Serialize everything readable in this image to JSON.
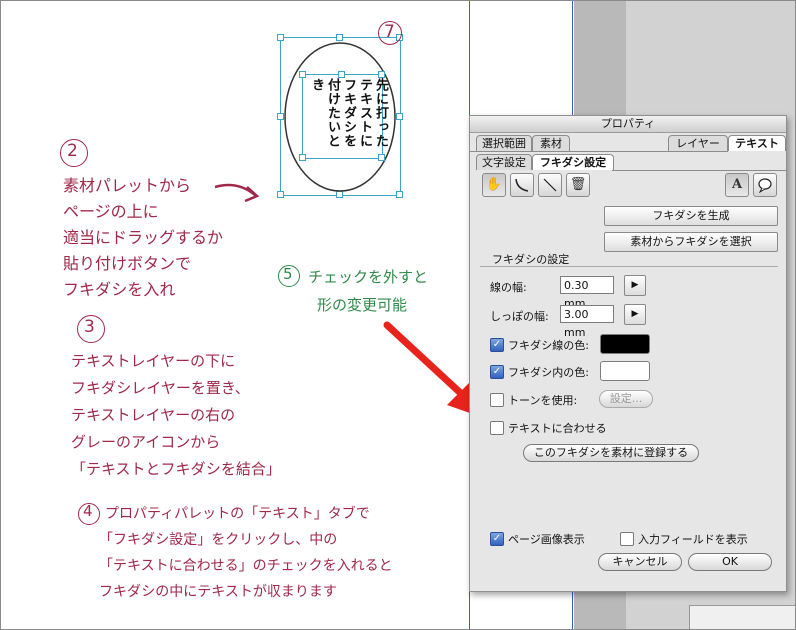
{
  "annotations": {
    "step2": {
      "number": "2",
      "lines": [
        "素材パレットから",
        "ページの上に",
        "適当にドラッグするか",
        "貼り付けボタンで",
        "フキダシを入れ"
      ]
    },
    "step3": {
      "number": "3",
      "lines": [
        "テキストレイヤーの下に",
        "フキダシレイヤーを置き、",
        "テキストレイヤーの右の",
        "グレーのアイコンから",
        "「テキストとフキダシを結合」"
      ]
    },
    "step4": {
      "number": "4",
      "lines": [
        "プロパティパレットの「テキスト」タブで",
        "「フキダシ設定」をクリックし、中の",
        "「テキストに合わせる」のチェックを入れると",
        "フキダシの中にテキストが収まります"
      ]
    },
    "step5": {
      "number": "5",
      "lines": [
        "チェックを外すと",
        "形の変更可能"
      ]
    },
    "step7": {
      "number": "7"
    }
  },
  "balloon": {
    "text": [
      "先に打った",
      "テキストに",
      "フキダシを",
      "付けたいとき"
    ]
  },
  "colors": {
    "maroon": "#a0284a",
    "green": "#2f8a4a",
    "arrow": "#e8231c",
    "line_color": "#000000",
    "fill_color": "#ffffff"
  },
  "panel": {
    "title": "プロパティ",
    "tabs_row1": {
      "left": [
        "選択範囲",
        "素材"
      ],
      "right": [
        "レイヤー",
        "テキスト"
      ],
      "active": "テキスト"
    },
    "tabs_row2": {
      "items": [
        "文字設定",
        "フキダシ設定"
      ],
      "active": "フキダシ設定"
    },
    "tools": {
      "left": [
        "hand-icon",
        "curve-icon",
        "line-icon",
        "trash-icon"
      ],
      "right": [
        "text-icon",
        "balloon-icon"
      ]
    },
    "create_button": "フキダシを生成",
    "select_button": "素材からフキダシを選択",
    "section_title": "フキダシの設定",
    "line_width": {
      "label": "線の幅:",
      "value": "0.30 mm"
    },
    "tail_width": {
      "label": "しっぽの幅:",
      "value": "3.00 mm"
    },
    "line_color": {
      "label": "フキダシ線の色:",
      "checked": true
    },
    "fill_color": {
      "label": "フキダシ内の色:",
      "checked": true
    },
    "tone": {
      "label": "トーンを使用:",
      "checked": false,
      "button": "設定..."
    },
    "fit_text": {
      "label": "テキストに合わせる",
      "checked": false
    },
    "register_button": "このフキダシを素材に登録する",
    "page_image": {
      "label": "ページ画像表示",
      "checked": true
    },
    "input_field": {
      "label": "入力フィールドを表示",
      "checked": false
    },
    "cancel_button": "キャンセル",
    "ok_button": "OK"
  }
}
